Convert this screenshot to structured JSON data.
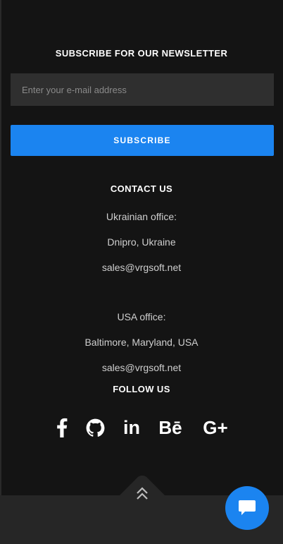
{
  "newsletter": {
    "title": "SUBSCRIBE FOR OUR NEWSLETTER",
    "email_placeholder": "Enter your e-mail address",
    "subscribe_label": "SUBSCRIBE"
  },
  "contact": {
    "title": "CONTACT US",
    "ukraine": {
      "heading": "Ukrainian office:",
      "location": "Dnipro, Ukraine",
      "email": "sales@vrgsoft.net"
    },
    "usa": {
      "heading": "USA office:",
      "location": "Baltimore, Maryland, USA",
      "email": "sales@vrgsoft.net"
    }
  },
  "follow": {
    "title": "FOLLOW US",
    "links": [
      {
        "icon": "facebook-icon"
      },
      {
        "icon": "github-icon"
      },
      {
        "icon": "linkedin-icon",
        "text": "in"
      },
      {
        "icon": "behance-icon",
        "text": "Bē"
      },
      {
        "icon": "google-plus-icon",
        "text": "G+"
      }
    ]
  },
  "colors": {
    "background": "#141414",
    "bottom_bar": "#262626",
    "input_bg": "#2f2f2f",
    "accent": "#1b84f0",
    "heading_text": "#ffffff",
    "body_text": "#cfcfcf"
  }
}
